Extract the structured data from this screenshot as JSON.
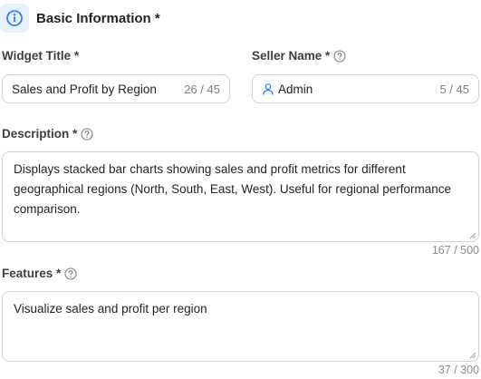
{
  "section": {
    "title": "Basic Information *",
    "icon": "info-icon"
  },
  "widget_title": {
    "label": "Widget Title *",
    "value": "Sales and Profit by Region",
    "count": "26 / 45"
  },
  "seller_name": {
    "label": "Seller Name *",
    "help_icon": "question-circle-icon",
    "user_icon": "user-icon",
    "value": "Admin",
    "count": "5 / 45"
  },
  "description": {
    "label": "Description *",
    "help_icon": "question-circle-icon",
    "value": "Displays stacked bar charts showing sales and profit metrics for different geographical regions (North, South, East, West). Useful for regional performance comparison.",
    "count": "167 / 500"
  },
  "features": {
    "label": "Features *",
    "help_icon": "question-circle-icon",
    "value": "Visualize sales and profit per region",
    "count": "37 / 300"
  },
  "colors": {
    "accent": "#1677ff",
    "border": "#cfd3d8",
    "badge_bg": "#e7f0fb"
  }
}
